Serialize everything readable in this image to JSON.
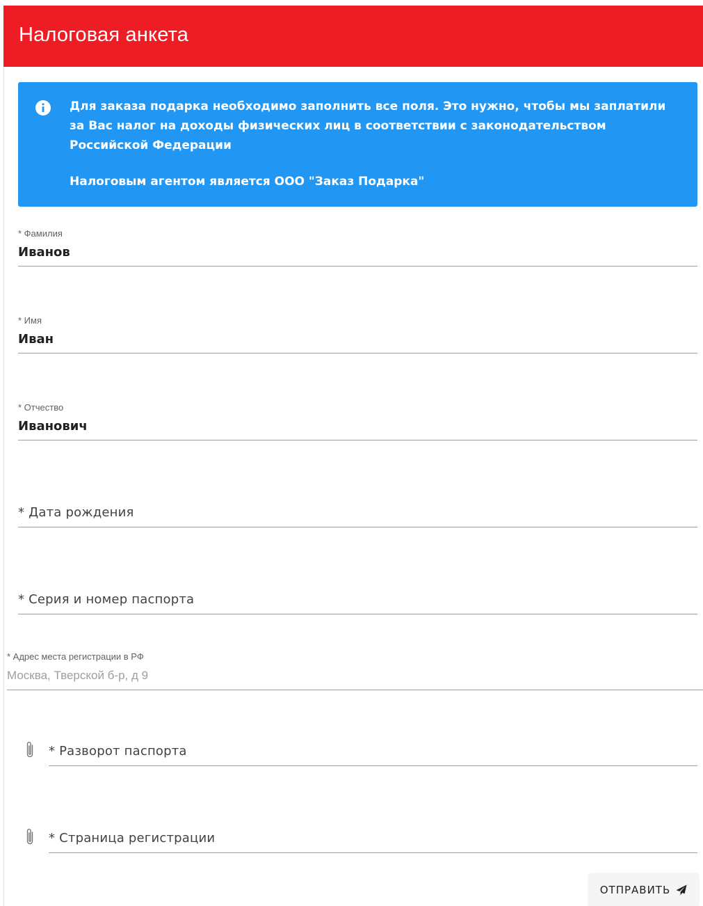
{
  "header": {
    "title": "Налоговая анкета",
    "color": "#ee1c25"
  },
  "info": {
    "icon": "info-icon",
    "color": "#2196f3",
    "paragraph1": "Для заказа подарка необходимо заполнить все поля. Это нужно, чтобы мы заплатили за Вас налог на доходы физических лиц в соответствии с законодательством Российской Федерации",
    "paragraph2": "Налоговым агентом является ООО \"Заказ Подарка\""
  },
  "form": {
    "last_name": {
      "label": "* Фамилия",
      "value": "Иванов"
    },
    "first_name": {
      "label": "* Имя",
      "value": "Иван"
    },
    "middle_name": {
      "label": "* Отчество",
      "value": "Иванович"
    },
    "birth_date": {
      "label": "* Дата рождения"
    },
    "passport": {
      "label": "* Серия и номер паспорта"
    },
    "address": {
      "label": "* Адрес места регистрации в РФ",
      "placeholder": "Москва, Тверской б-р, д 9"
    },
    "passport_spread": {
      "label": "* Разворот паспорта",
      "icon": "paperclip-icon"
    },
    "registration_page": {
      "label": "* Страница регистрации",
      "icon": "paperclip-icon"
    }
  },
  "submit": {
    "label": "ОТПРАВИТЬ",
    "icon": "send-icon"
  }
}
